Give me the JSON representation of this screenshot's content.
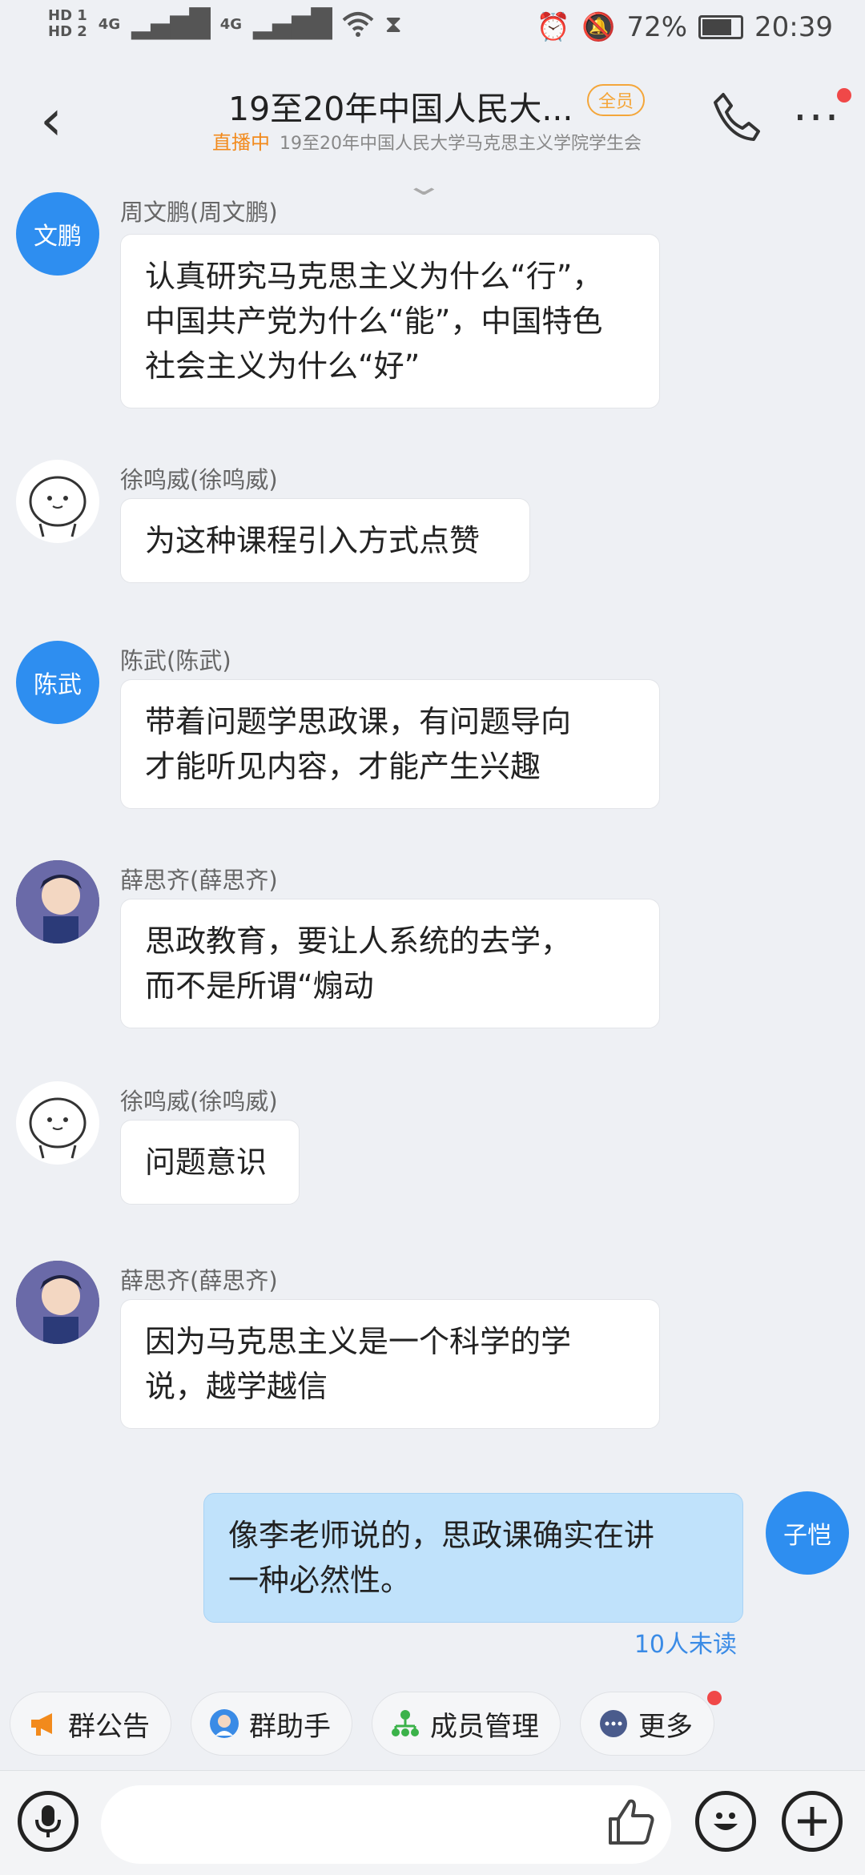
{
  "status": {
    "hd1": "HD 1",
    "hd2": "HD 2",
    "net1": "4G",
    "net2": "4G",
    "battery": "72%",
    "time": "20:39"
  },
  "header": {
    "title": "19至20年中国人民大...",
    "badge": "全员",
    "live_label": "直播中",
    "subtitle": "19至20年中国人民大学马克思主义学院学生会"
  },
  "messages": [
    {
      "avatar_text": "文鹏",
      "sender": "周文鹏(周文鹏)",
      "lines": [
        "认真研究马克思主义为什么“行”，",
        "中国共产党为什么“能”，中国特色",
        "社会主义为什么“好”"
      ]
    },
    {
      "avatar_text": "",
      "sender": "徐鸣威(徐鸣威)",
      "lines": [
        "为这种课程引入方式点赞"
      ]
    },
    {
      "avatar_text": "陈武",
      "sender": "陈武(陈武)",
      "lines": [
        "带着问题学思政课，有问题导向",
        "才能听见内容，才能产生兴趣"
      ]
    },
    {
      "avatar_text": "",
      "sender": "薛思齐(薛思齐)",
      "lines": [
        "思政教育，要让人系统的去学，",
        "而不是所谓“煽动"
      ]
    },
    {
      "avatar_text": "",
      "sender": "徐鸣威(徐鸣威)",
      "lines": [
        "问题意识"
      ]
    },
    {
      "avatar_text": "",
      "sender": "薛思齐(薛思齐)",
      "lines": [
        "因为马克思主义是一个科学的学",
        "说，越学越信"
      ]
    }
  ],
  "my_message": {
    "avatar_text": "子恺",
    "lines": [
      "像李老师说的，思政课确实在讲",
      "一种必然性。"
    ],
    "unread": "10人未读"
  },
  "quick_actions": [
    {
      "label": "群公告",
      "icon": "megaphone-icon"
    },
    {
      "label": "群助手",
      "icon": "assistant-icon"
    },
    {
      "label": "成员管理",
      "icon": "member-tree-icon"
    },
    {
      "label": "更多",
      "icon": "more-icon"
    }
  ],
  "colors": {
    "accent": "#2e8ef0",
    "live": "#f28a1c",
    "badge": "#f4a63a",
    "my_bubble": "#c0e2fb",
    "notify": "#f04848"
  }
}
